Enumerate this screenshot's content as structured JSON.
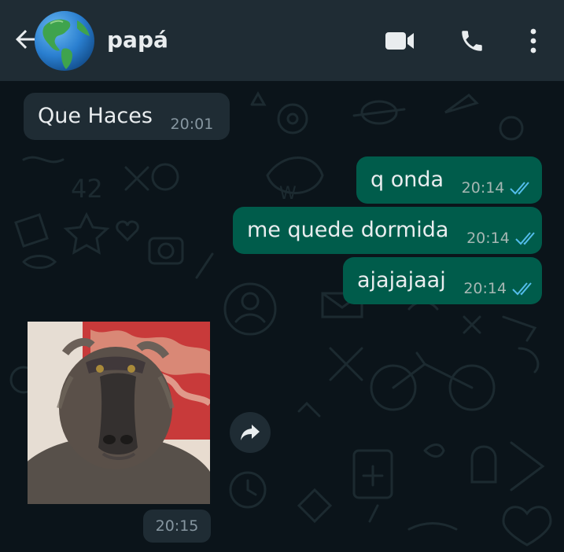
{
  "header": {
    "back_icon": "arrow-left-icon",
    "avatar_icon": "globe-americas-emoji",
    "contact_name": "papá",
    "actions": [
      "video-call-icon",
      "phone-icon",
      "more-vert-icon"
    ]
  },
  "messages": [
    {
      "direction": "incoming",
      "text": "Que Haces",
      "time": "20:01"
    },
    {
      "direction": "outgoing",
      "text": "q onda",
      "time": "20:14",
      "status": "read"
    },
    {
      "direction": "outgoing",
      "text": "me quede dormida",
      "time": "20:14",
      "status": "read"
    },
    {
      "direction": "outgoing",
      "text": "ajajajaaj",
      "time": "20:14",
      "status": "read"
    },
    {
      "direction": "incoming",
      "type": "sticker",
      "sticker_subject": "baboon",
      "time": "20:15"
    }
  ],
  "colors": {
    "header_bg": "#1f2c34",
    "chat_bg": "#0b141a",
    "incoming_bubble": "#1f2c34",
    "outgoing_bubble": "#005c4b",
    "read_tick": "#53bdeb"
  }
}
